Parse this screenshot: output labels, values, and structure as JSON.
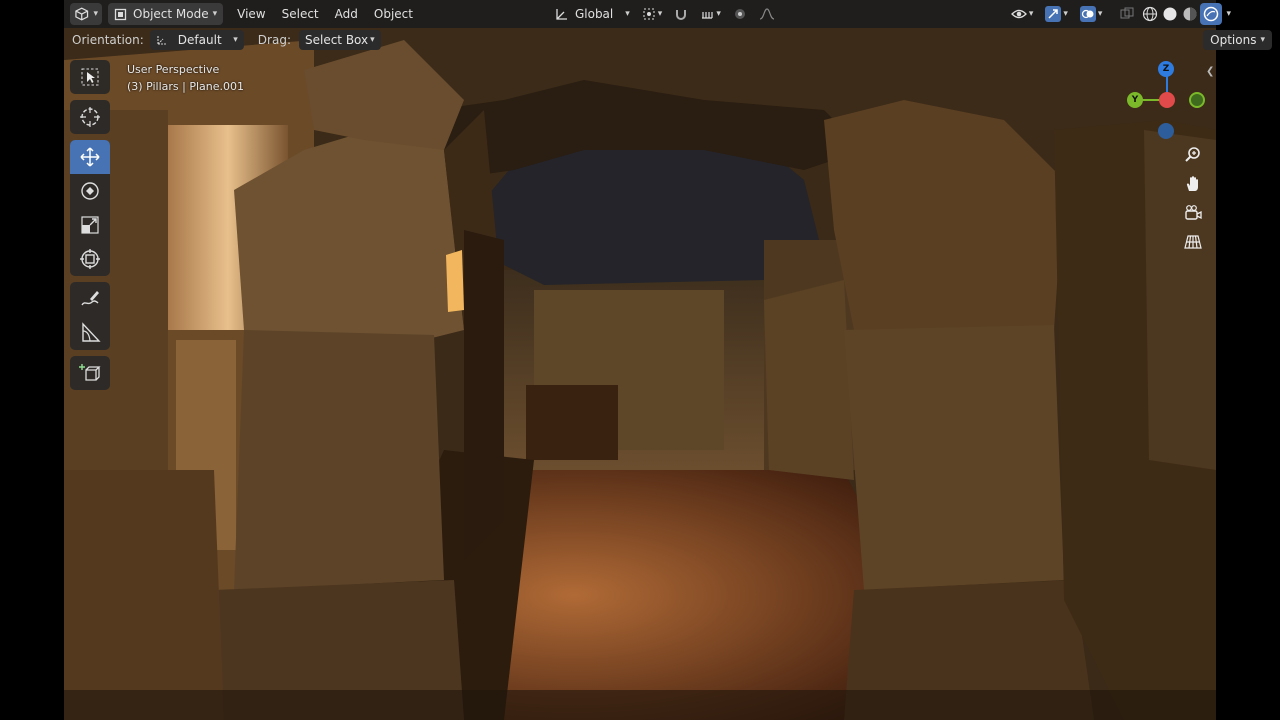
{
  "header": {
    "editor_type_icon": "viewport-icon",
    "mode": "Object Mode",
    "menus": [
      "View",
      "Select",
      "Add",
      "Object"
    ],
    "transform_orientation": "Global"
  },
  "subheader": {
    "orientation_label": "Orientation:",
    "orientation_value": "Default",
    "drag_label": "Drag:",
    "drag_value": "Select Box",
    "options_label": "Options"
  },
  "view_info": {
    "perspective": "User Perspective",
    "context": "(3) Pillars | Plane.001"
  },
  "toolbar": {
    "tools": [
      "select-box",
      "cursor",
      "move",
      "rotate",
      "scale",
      "transform",
      "annotate",
      "measure",
      "add-cube"
    ],
    "active_tool": "move"
  },
  "gizmo": {
    "axes": {
      "z": "Z",
      "y": "Y"
    },
    "colors": {
      "x": "#e04a4a",
      "y": "#7bb82a",
      "z": "#2f7ce0",
      "neg_y": "#3f6b1e",
      "neg_z": "#2d5d9a"
    }
  },
  "colors": {
    "accent": "#4772b3",
    "header_bg": "#1e1e1e",
    "scene_warm": "#f0c27a",
    "scene_dark": "#2a1c10"
  }
}
